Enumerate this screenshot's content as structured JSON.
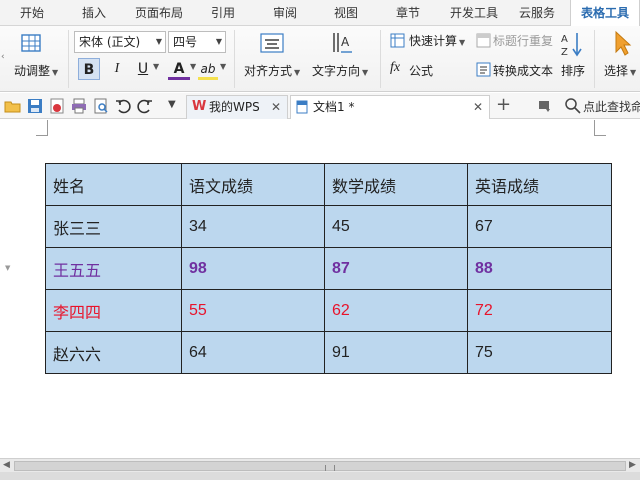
{
  "ribbon_tabs": [
    "开始",
    "插入",
    "页面布局",
    "引用",
    "审阅",
    "视图",
    "章节",
    "开发工具",
    "云服务",
    "表格工具"
  ],
  "ribbon": {
    "auto_adjust": "动调整",
    "font_name": "宋体 (正文)",
    "font_size": "四号",
    "bold": "B",
    "italic": "I",
    "underline": "U",
    "font_color_glyph": "A",
    "highlight_glyph": "ab",
    "align_label": "对齐方式",
    "text_direction_label": "文字方向",
    "quick_calc_label": "快速计算",
    "repeat_header_label": "标题行重复",
    "formula_label": "公式",
    "to_text_label": "转换成文本",
    "sort_label": "排序",
    "select_label": "选择"
  },
  "quick_access": {
    "my_wps_tab": "我的WPS",
    "doc_tab": "文档1 *",
    "search_label": "点此查找命"
  },
  "table": {
    "header": [
      "姓名",
      "语文成绩",
      "数学成绩",
      "英语成绩"
    ],
    "rows": [
      {
        "name": "张三三",
        "chinese": "34",
        "math": "45",
        "english": "67",
        "style": "normal"
      },
      {
        "name": "王五五",
        "chinese": "98",
        "math": "87",
        "english": "88",
        "style": "purple"
      },
      {
        "name": "李四四",
        "chinese": "55",
        "math": "62",
        "english": "72",
        "style": "red"
      },
      {
        "name": "赵六六",
        "chinese": "64",
        "math": "91",
        "english": "75",
        "style": "normal"
      }
    ]
  },
  "colors": {
    "cell_fill": "#bcd7ee",
    "highlight_purple": "#7030a0",
    "highlight_red": "#e8132b",
    "accent_blue": "#2b6cb0"
  }
}
